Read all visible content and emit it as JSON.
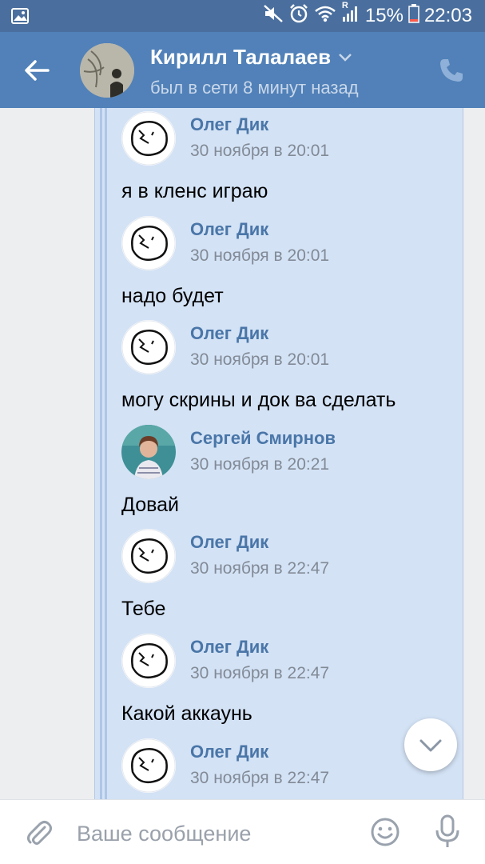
{
  "status_bar": {
    "left_icon": "image-icon",
    "icons": [
      "mute-icon",
      "alarm-icon",
      "wifi-icon",
      "signal-icon"
    ],
    "roaming_mark": "R",
    "battery_percent": "15%",
    "time": "22:03"
  },
  "header": {
    "title": "Кирилл Талалаев",
    "subtitle": "был в сети 8 минут назад",
    "back_icon": "arrow-left-icon",
    "dropdown_icon": "chevron-down-icon",
    "call_icon": "phone-icon"
  },
  "messages": [
    {
      "author": "Олег Дик",
      "date": "30 ноября в 20:01",
      "text": "я в кленс играю",
      "avatar": "doodle-face-avatar"
    },
    {
      "author": "Олег Дик",
      "date": "30 ноября в 20:01",
      "text": "надо будет",
      "avatar": "doodle-face-avatar"
    },
    {
      "author": "Олег Дик",
      "date": "30 ноября в 20:01",
      "text": "могу скрины и док ва сделать",
      "avatar": "doodle-face-avatar"
    },
    {
      "author": "Сергей Смирнов",
      "date": "30 ноября в 20:21",
      "text": "Довай",
      "avatar": "photo-avatar"
    },
    {
      "author": "Олег Дик",
      "date": "30 ноября в 22:47",
      "text": "Тебе",
      "avatar": "doodle-face-avatar"
    },
    {
      "author": "Олег Дик",
      "date": "30 ноября в 22:47",
      "text": "Какой аккаунь",
      "avatar": "doodle-face-avatar"
    },
    {
      "author": "Олег Дик",
      "date": "30 ноября в 22:47",
      "text": "",
      "avatar": "doodle-face-avatar"
    }
  ],
  "input": {
    "placeholder": "Ваше сообщение",
    "value": "",
    "attach_icon": "paperclip-icon",
    "emoji_icon": "smile-icon",
    "mic_icon": "microphone-icon"
  },
  "scroll_button_icon": "chevron-down-icon",
  "colors": {
    "status_bar": "#4a6f9e",
    "header": "#5181b8",
    "forward_bg": "#d3e2f5",
    "author": "#4a76a8",
    "date": "#828a96",
    "icon_grey": "#99a2ad"
  }
}
